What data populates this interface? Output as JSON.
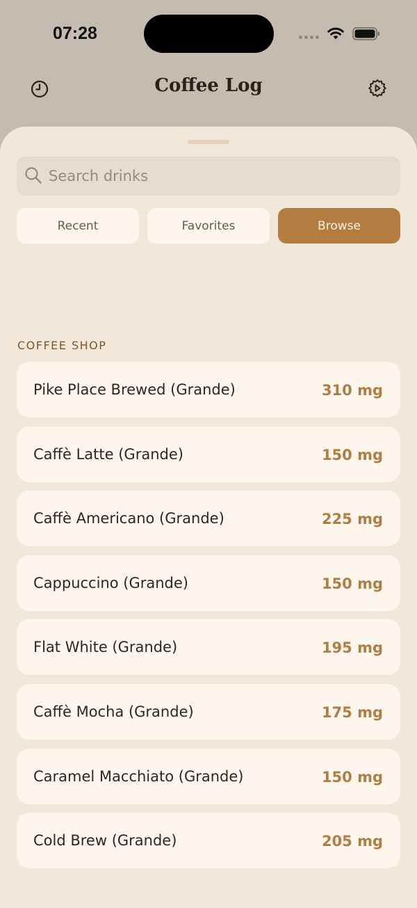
{
  "status": {
    "time": "07:28"
  },
  "header": {
    "title": "Coffee Log",
    "left_icon": "history-clock-icon",
    "right_icon": "gear-icon"
  },
  "search": {
    "placeholder": "Search drinks",
    "value": "",
    "icon": "search-icon"
  },
  "tabs": [
    {
      "label": "Recent",
      "active": false
    },
    {
      "label": "Favorites",
      "active": false
    },
    {
      "label": "Browse",
      "active": true
    }
  ],
  "section": {
    "title": "COFFEE SHOP"
  },
  "drinks": [
    {
      "name": "Pike Place Brewed (Grande)",
      "caffeine": "310 mg"
    },
    {
      "name": "Caffè Latte (Grande)",
      "caffeine": "150 mg"
    },
    {
      "name": "Caffè Americano (Grande)",
      "caffeine": "225 mg"
    },
    {
      "name": "Cappuccino (Grande)",
      "caffeine": "150 mg"
    },
    {
      "name": "Flat White (Grande)",
      "caffeine": "195 mg"
    },
    {
      "name": "Caffè Mocha (Grande)",
      "caffeine": "175 mg"
    },
    {
      "name": "Caramel Macchiato (Grande)",
      "caffeine": "150 mg"
    },
    {
      "name": "Cold Brew (Grande)",
      "caffeine": "205 mg"
    }
  ],
  "colors": {
    "accent": "#b37d3f",
    "caffeine_text": "#b07e45",
    "sheet_background": "#f1e8d9",
    "header_background": "#c5bcb1"
  }
}
